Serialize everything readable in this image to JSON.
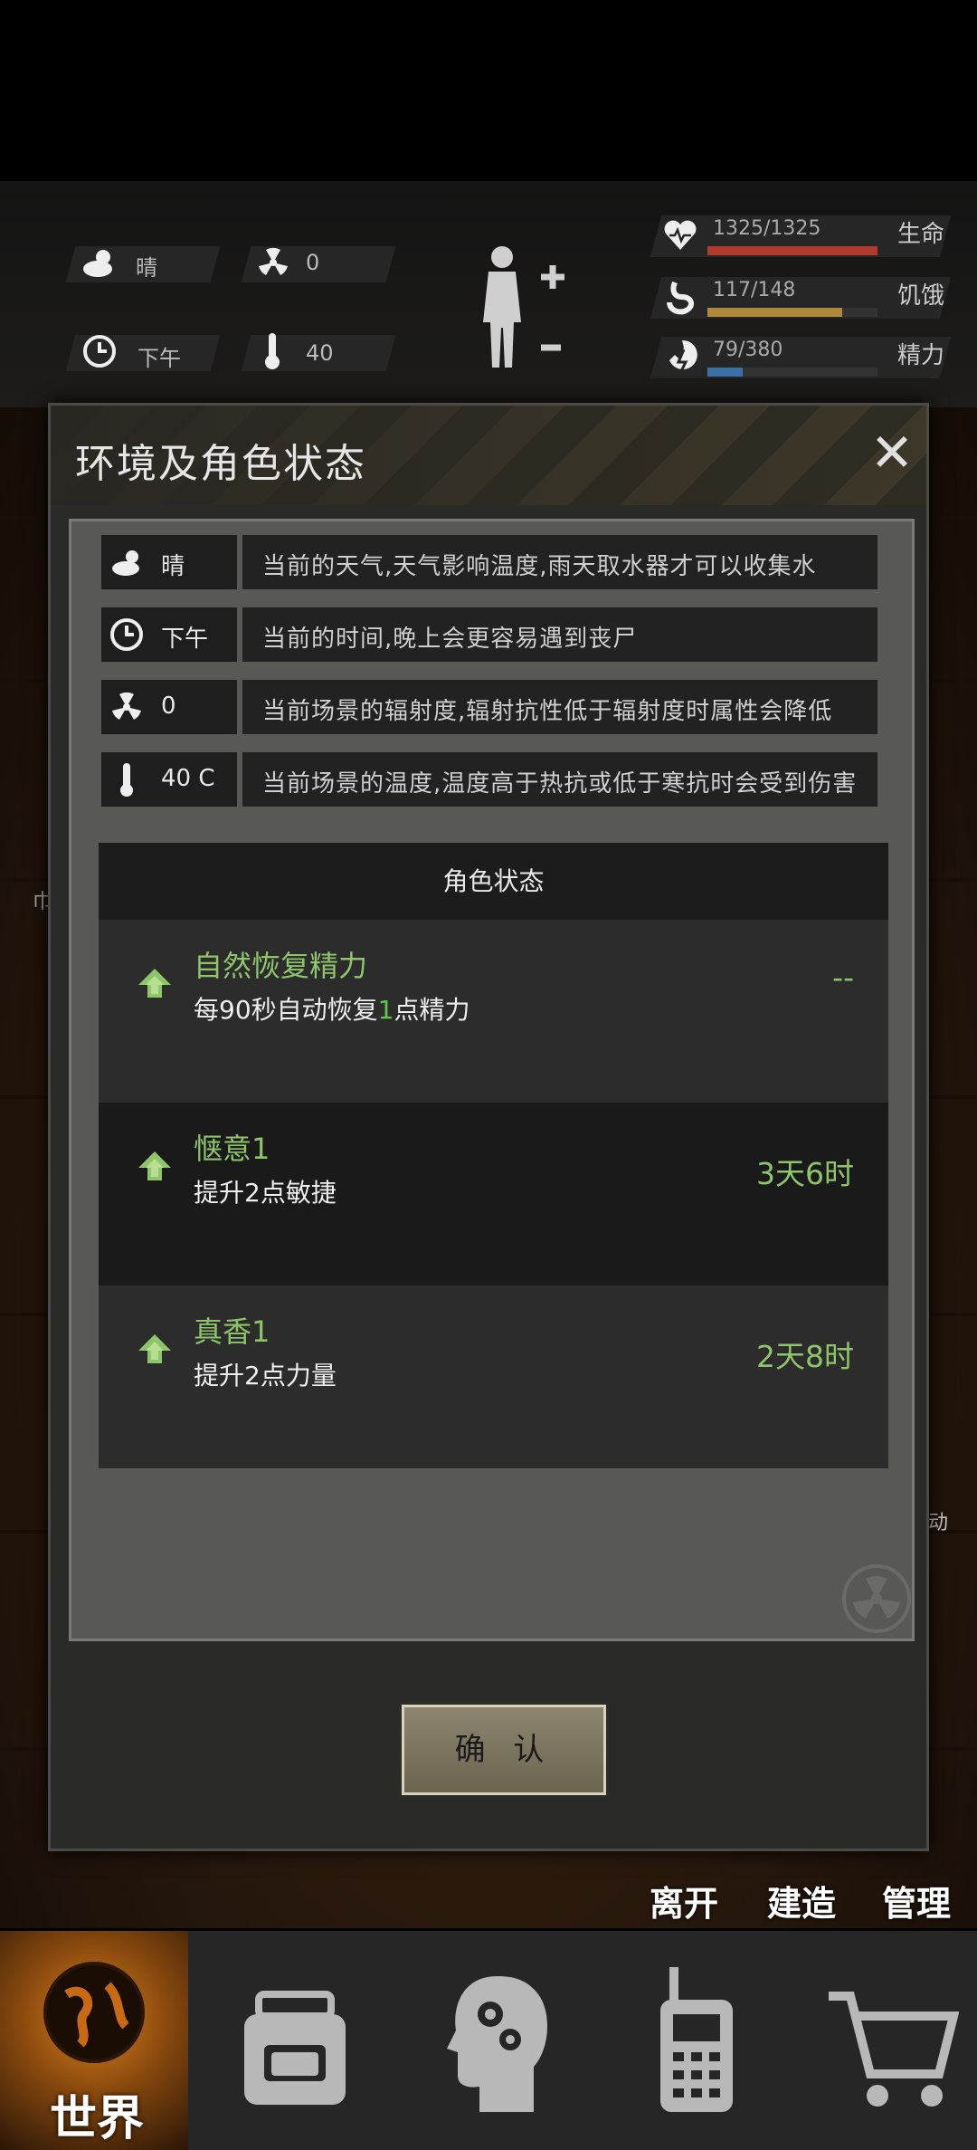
{
  "hud": {
    "weather": "晴",
    "radiation": "0",
    "time": "下午",
    "temperature": "40",
    "health_label": "生命",
    "health_value": "1325/1325",
    "health_fraction": 1.0,
    "hunger_label": "饥饿",
    "hunger_value": "117/148",
    "hunger_fraction": 0.79,
    "energy_label": "精力",
    "energy_value": "79/380",
    "energy_fraction": 0.21,
    "colors": {
      "health": "#b03a2e",
      "hunger": "#b08a3c",
      "energy": "#3c6ea8"
    }
  },
  "dialog": {
    "title": "环境及角色状态",
    "close_icon": "close-icon",
    "environment": [
      {
        "icon": "weather-sun-cloud-icon",
        "value": "晴",
        "desc": "当前的天气,天气影响温度,雨天取水器才可以收集水"
      },
      {
        "icon": "clock-icon",
        "value": "下午",
        "desc": "当前的时间,晚上会更容易遇到丧尸"
      },
      {
        "icon": "radiation-icon",
        "value": "0",
        "desc": "当前场景的辐射度,辐射抗性低于辐射度时属性会降低"
      },
      {
        "icon": "thermometer-icon",
        "value": "40 C",
        "desc": "当前场景的温度,温度高于热抗或低于寒抗时会受到伤害"
      }
    ],
    "status_header": "角色状态",
    "statuses": [
      {
        "name": "自然恢复精力",
        "desc_before": "每90秒自动恢复",
        "desc_num": "1",
        "desc_after": "点精力",
        "time": "--"
      },
      {
        "name": "惬意1",
        "desc": "提升2点敏捷",
        "time": "3天6时"
      },
      {
        "name": "真香1",
        "desc": "提升2点力量",
        "time": "2天8时"
      }
    ],
    "confirm_label": "确 认"
  },
  "background_labels": {
    "leave": "离开",
    "build": "建造",
    "manage": "管理",
    "side_text": "动",
    "side_text_left": "巾"
  },
  "bottom_nav": {
    "world_label": "世界",
    "items": [
      "backpack-icon",
      "brain-skills-icon",
      "radio-icon",
      "shopping-cart-icon"
    ]
  }
}
